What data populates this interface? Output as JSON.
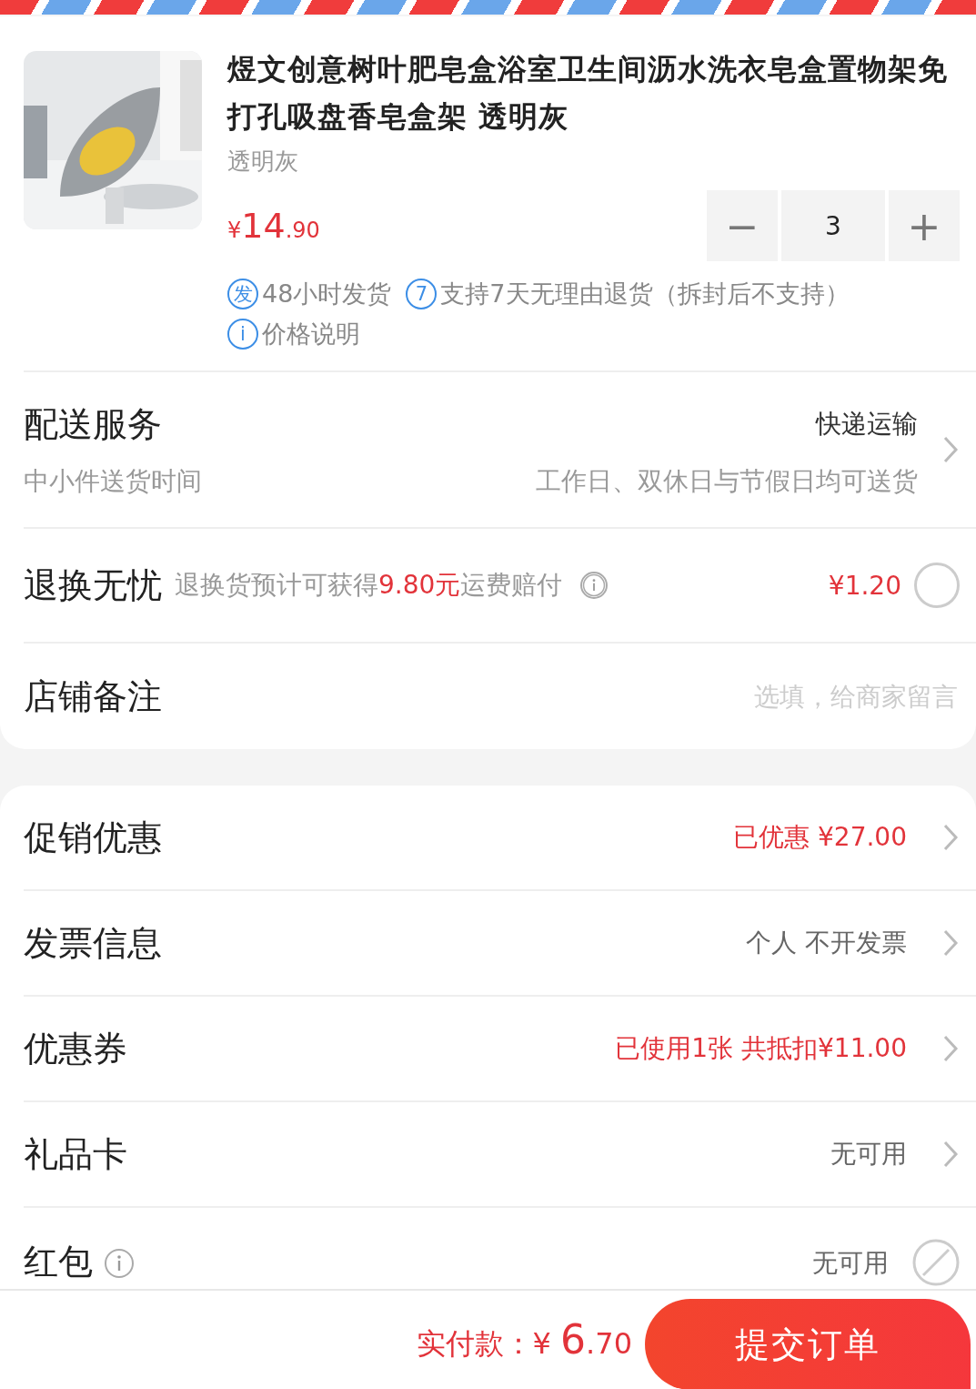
{
  "product": {
    "title": "煜文创意树叶肥皂盒浴室卫生间沥水洗衣皂盒置物架免打孔吸盘香皂盒架 透明灰",
    "variant": "透明灰",
    "price": {
      "currency": "¥",
      "integer": "14",
      "decimal": ".90"
    },
    "quantity": {
      "minus": "−",
      "value": "3",
      "plus": "+"
    },
    "tags": [
      {
        "icon": "发",
        "text": "48小时发货"
      },
      {
        "icon": "7",
        "text": "支持7天无理由退货（拆封后不支持）"
      },
      {
        "icon": "i",
        "text": "价格说明"
      }
    ]
  },
  "delivery": {
    "label": "配送服务",
    "value": "快递运输",
    "sublabel": "中小件送货时间",
    "subvalue": "工作日、双休日与节假日均可送货"
  },
  "return_service": {
    "label": "退换无忧",
    "note_before": "退换货预计可获得",
    "note_amount": "9.80元",
    "note_after": "运费赔付",
    "price": "¥1.20",
    "checked": false
  },
  "shop_note": {
    "label": "店铺备注",
    "placeholder": "选填，给商家留言"
  },
  "settings": [
    {
      "label": "促销优惠",
      "value": "已优惠 ¥27.00",
      "highlight": true,
      "kind": "chevron",
      "info": false
    },
    {
      "label": "发票信息",
      "value": "个人 不开发票",
      "highlight": false,
      "kind": "chevron",
      "info": false
    },
    {
      "label": "优惠券",
      "value": "已使用1张 共抵扣¥11.00",
      "highlight": true,
      "kind": "chevron",
      "info": false
    },
    {
      "label": "礼品卡",
      "value": "无可用",
      "highlight": false,
      "kind": "chevron",
      "info": false
    },
    {
      "label": "红包",
      "value": "无可用",
      "highlight": false,
      "kind": "unavailable",
      "info": true
    }
  ],
  "footer": {
    "label": "实付款：",
    "currency": "¥",
    "integer": "6",
    "decimal": ".70",
    "submit": "提交订单"
  }
}
